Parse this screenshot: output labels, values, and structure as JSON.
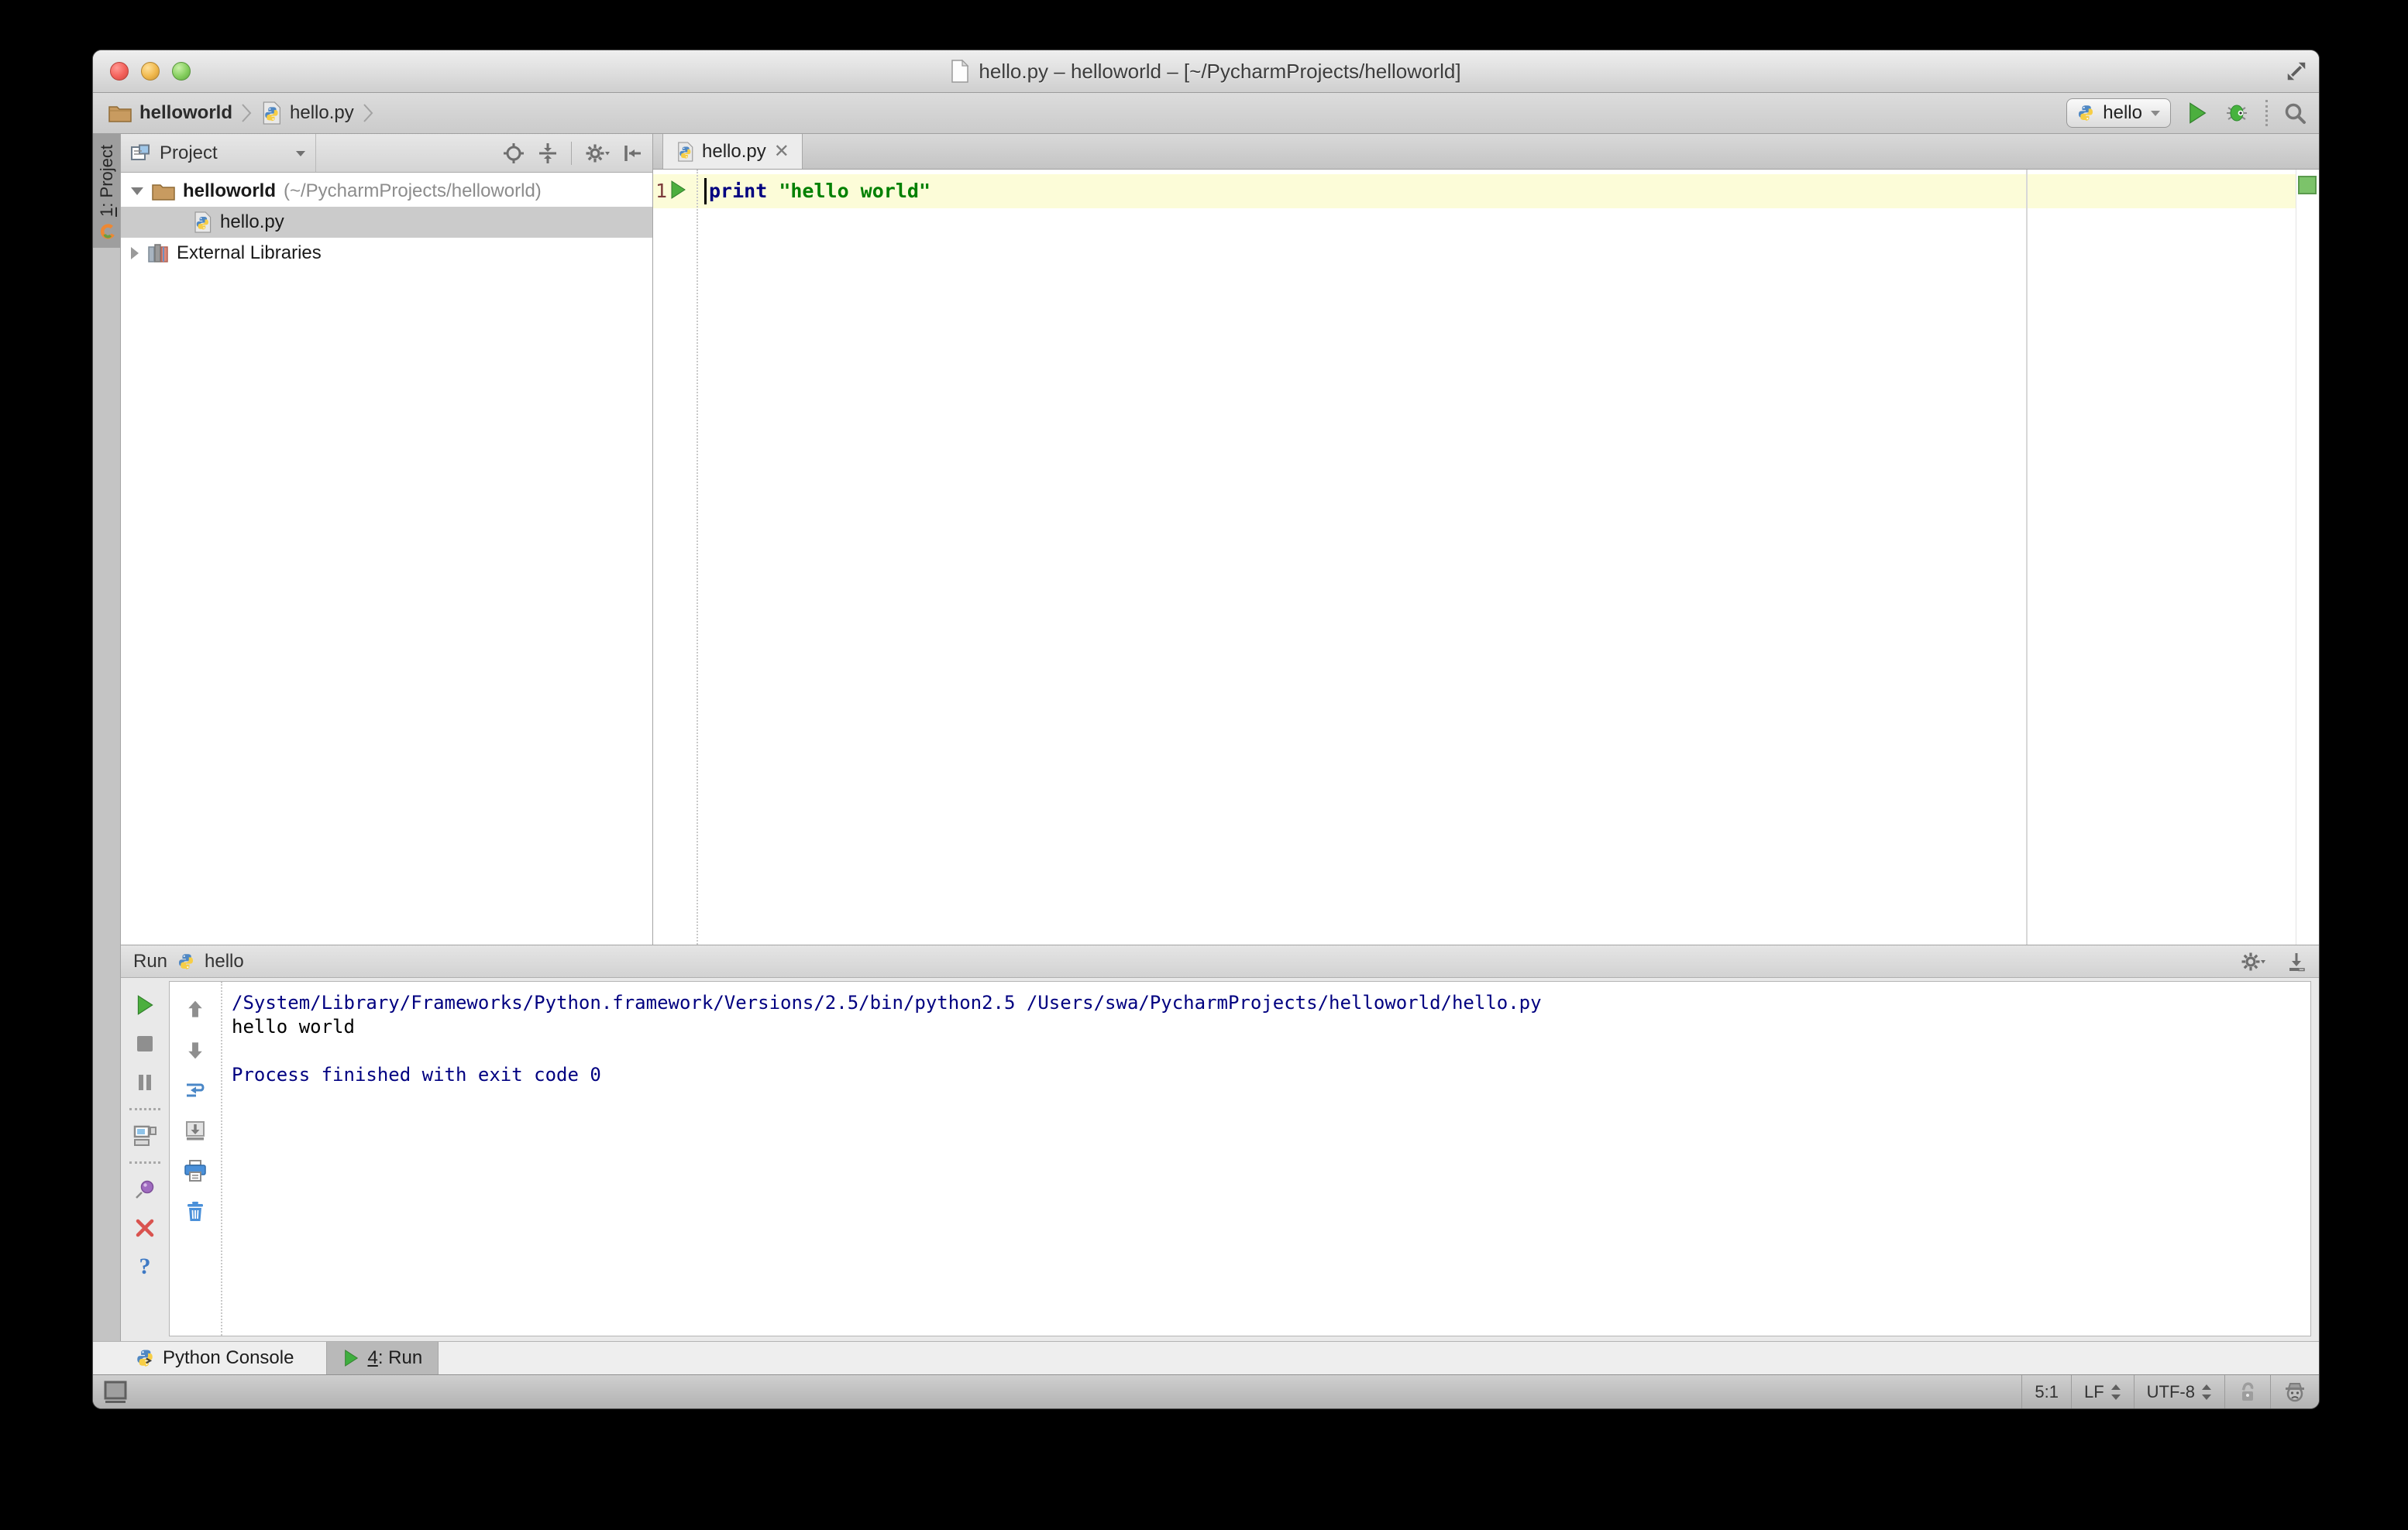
{
  "window": {
    "title": "hello.py – helloworld – [~/PycharmProjects/helloworld]"
  },
  "navbar": {
    "breadcrumbs": [
      {
        "label": "helloworld"
      },
      {
        "label": "hello.py"
      }
    ],
    "run_config": "hello"
  },
  "stripe": {
    "project_tab": {
      "number": "1",
      "suffix": ": Project"
    }
  },
  "project_panel": {
    "header_label": "Project",
    "tree": [
      {
        "name": "helloworld",
        "path": "(~/PycharmProjects/helloworld)"
      },
      {
        "name": "hello.py"
      },
      {
        "name": "External Libraries"
      }
    ]
  },
  "editor": {
    "tab_label": "hello.py",
    "close_glyph": "✕",
    "line_number": "1",
    "code": {
      "keyword": "print",
      "space": " ",
      "string": "\"hello world\""
    }
  },
  "run_panel": {
    "header_label": "Run",
    "header_config": "hello",
    "console": {
      "line1": "/System/Library/Frameworks/Python.framework/Versions/2.5/bin/python2.5 /Users/swa/PycharmProjects/helloworld/hello.py",
      "line2": "hello world",
      "line3": "",
      "line4": "Process finished with exit code 0"
    }
  },
  "bottom_bar": {
    "python_console": "Python Console",
    "run_tab": {
      "number": "4",
      "suffix": ": Run"
    }
  },
  "status_bar": {
    "caret_position": "5:1",
    "line_separator": "LF",
    "encoding": "UTF-8"
  },
  "colors": {
    "keyword": "#000080",
    "string": "#008000",
    "console_system": "#000080",
    "current_line_bg": "#fcfcd8",
    "run_green": "#4caf3e",
    "inspection_ok": "#7cc36a",
    "selection_gray": "#cbcbcb"
  }
}
